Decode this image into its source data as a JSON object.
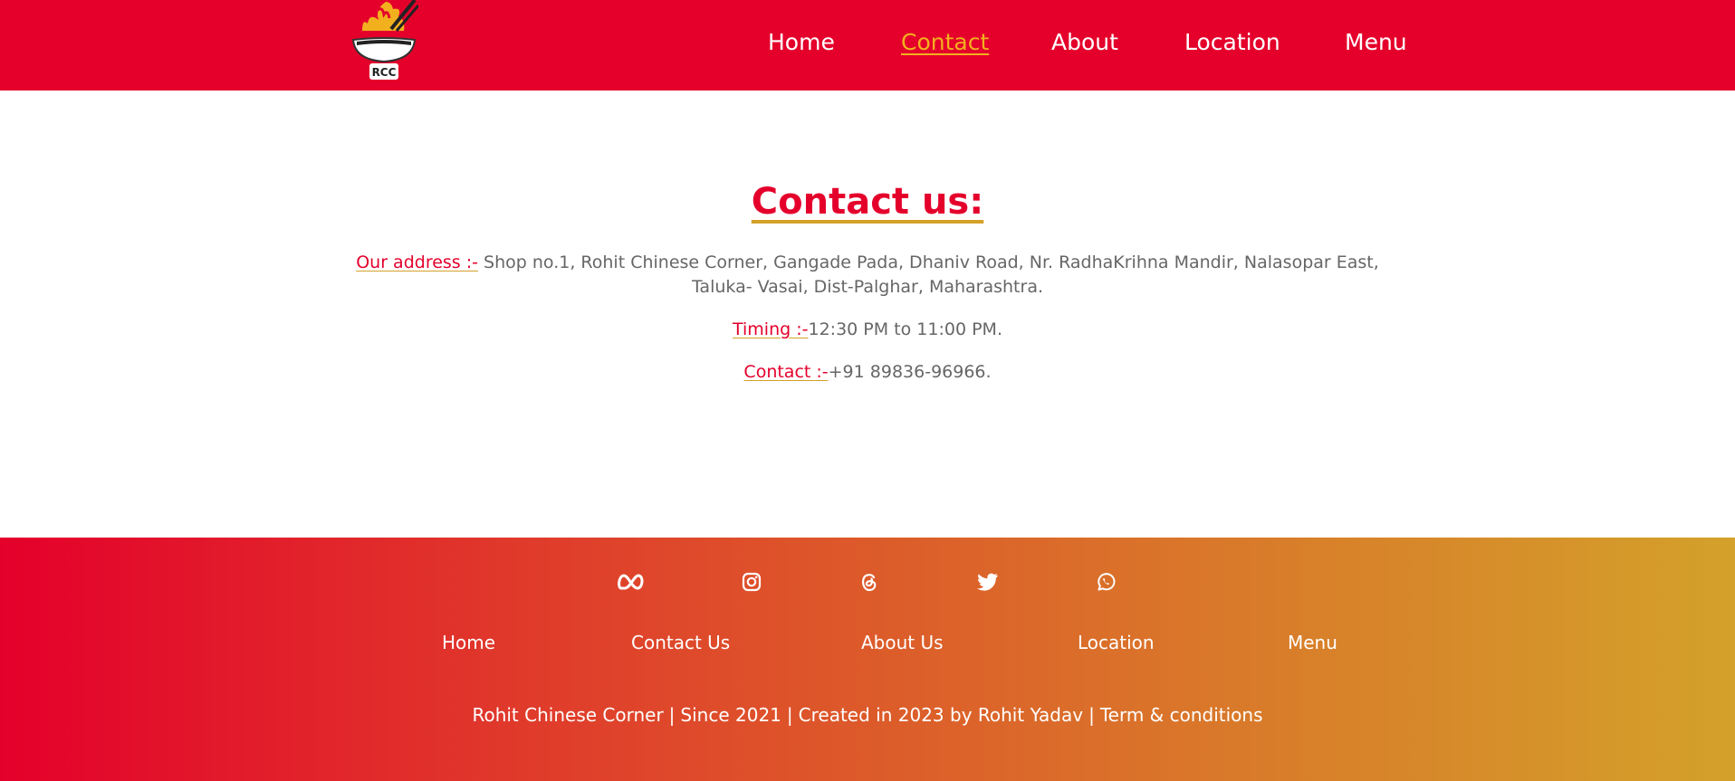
{
  "header": {
    "logo_text": "RCC",
    "nav": [
      {
        "label": "Home"
      },
      {
        "label": "Contact"
      },
      {
        "label": "About"
      },
      {
        "label": "Location"
      },
      {
        "label": "Menu"
      }
    ],
    "active_index": 1
  },
  "contact": {
    "title": "Contact us:",
    "address_label": "Our address :-",
    "address_line1": " Shop no.1, Rohit Chinese Corner, Gangade Pada, Dhaniv Road, Nr. RadhaKrihna Mandir, Nalasopar East,",
    "address_line2": "Taluka- Vasai, Dist-Palghar, Maharashtra.",
    "timing_label": "Timing :-",
    "timing_value": "12:30 PM to 11:00 PM.",
    "contact_label": "Contact :-",
    "contact_value": "+91 89836-96966."
  },
  "footer": {
    "social_icons": [
      "meta-icon",
      "instagram-icon",
      "threads-icon",
      "twitter-icon",
      "whatsapp-icon"
    ],
    "links": [
      "Home",
      "Contact Us",
      "About Us",
      "Location",
      "Menu"
    ],
    "copyright": [
      "Rohit Chinese Corner",
      "Since 2021",
      "Created in 2023 by Rohit Yadav",
      "Term & conditions"
    ],
    "separator": "|"
  },
  "colors": {
    "brand_red": "#e4002b",
    "accent_gold": "#d4a12a",
    "active_link": "#f2b01e",
    "body_text": "#666666"
  }
}
